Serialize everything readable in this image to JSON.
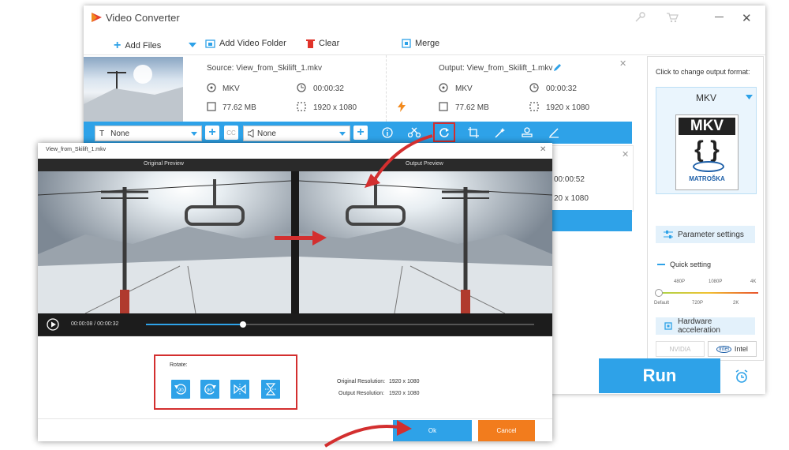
{
  "app": {
    "title": "Video Converter"
  },
  "toolbar": {
    "add_files": "Add Files",
    "add_folder": "Add Video Folder",
    "clear": "Clear",
    "merge": "Merge"
  },
  "file": {
    "source": "Source: View_from_Skilift_1.mkv",
    "output": "Output: View_from_Skilift_1.mkv",
    "src_format": "MKV",
    "src_duration": "00:00:32",
    "src_size": "77.62 MB",
    "src_resolution": "1920 x 1080",
    "out_format": "MKV",
    "out_duration": "00:00:32",
    "out_size": "77.62 MB",
    "out_resolution": "1920 x 1080"
  },
  "second_row": {
    "duration_partial": "00:00:52",
    "resolution_partial": "20 x 1080"
  },
  "edit_bar": {
    "subtitle": "None",
    "audio": "None"
  },
  "right_panel": {
    "hint": "Click to change output format:",
    "format": "MKV",
    "logo_text": "MKV",
    "logo_sub": "MATROŠKA",
    "param_settings": "Parameter settings",
    "quick_setting": "Quick setting",
    "quality_top": [
      "480P",
      "1080P",
      "4K"
    ],
    "quality_bottom": [
      "Default",
      "720P",
      "2K"
    ],
    "hw_accel": "Hardware acceleration",
    "nvidia": "NVIDIA",
    "intel": "Intel",
    "run": "Run"
  },
  "dialog": {
    "title": "View_from_Skilift_1.mkv",
    "original_preview": "Original Preview",
    "output_preview": "Output Preview",
    "time_current": "00:00:08",
    "time_sep": "/",
    "time_total": "00:00:32",
    "progress": 0.25,
    "rotate_label": "Rotate:",
    "rotate_buttons": [
      "90",
      "90"
    ],
    "orig_res_label": "Original Resolution:",
    "orig_res": "1920 x 1080",
    "out_res_label": "Output Resolution:",
    "out_res": "1920 x 1080",
    "ok": "Ok",
    "cancel": "Cancel"
  },
  "colors": {
    "accent": "#2ea2e8",
    "highlight": "#d32f2f",
    "cancel": "#f27c1d"
  }
}
